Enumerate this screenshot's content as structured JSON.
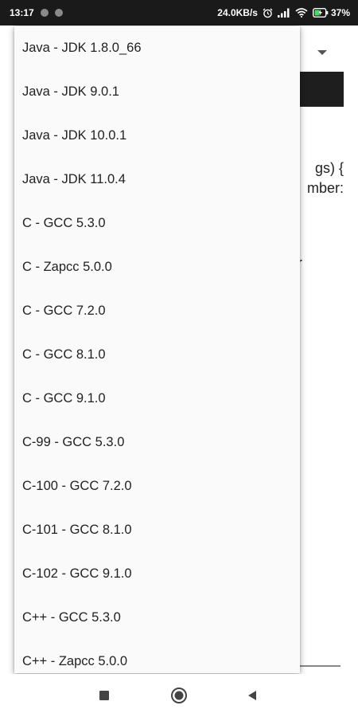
{
  "status_bar": {
    "time": "13:17",
    "net_speed": "24.0KB/s",
    "battery": "37%"
  },
  "background": {
    "code_lines": [
      "gs) {",
      "mber:"
    ],
    "code_line3": "r"
  },
  "dropdown": {
    "items": [
      {
        "label": "Java - JDK 1.8.0_66"
      },
      {
        "label": "Java - JDK 9.0.1"
      },
      {
        "label": "Java - JDK 10.0.1"
      },
      {
        "label": "Java - JDK 11.0.4"
      },
      {
        "label": "C - GCC 5.3.0"
      },
      {
        "label": "C - Zapcc 5.0.0"
      },
      {
        "label": "C - GCC 7.2.0"
      },
      {
        "label": "C - GCC 8.1.0"
      },
      {
        "label": "C - GCC 9.1.0"
      },
      {
        "label": "C-99 - GCC 5.3.0"
      },
      {
        "label": "C-100 - GCC 7.2.0"
      },
      {
        "label": "C-101 - GCC 8.1.0"
      },
      {
        "label": "C-102 - GCC 9.1.0"
      },
      {
        "label": "C++ - GCC 5.3.0"
      },
      {
        "label": "C++ - Zapcc 5.0.0"
      }
    ]
  },
  "icons": {
    "alarm": "alarm-icon",
    "signal": "signal-icon",
    "wifi": "wifi-icon",
    "battery": "battery-charging-icon",
    "recent": "recent-apps-icon",
    "home": "home-icon",
    "back": "back-icon"
  }
}
